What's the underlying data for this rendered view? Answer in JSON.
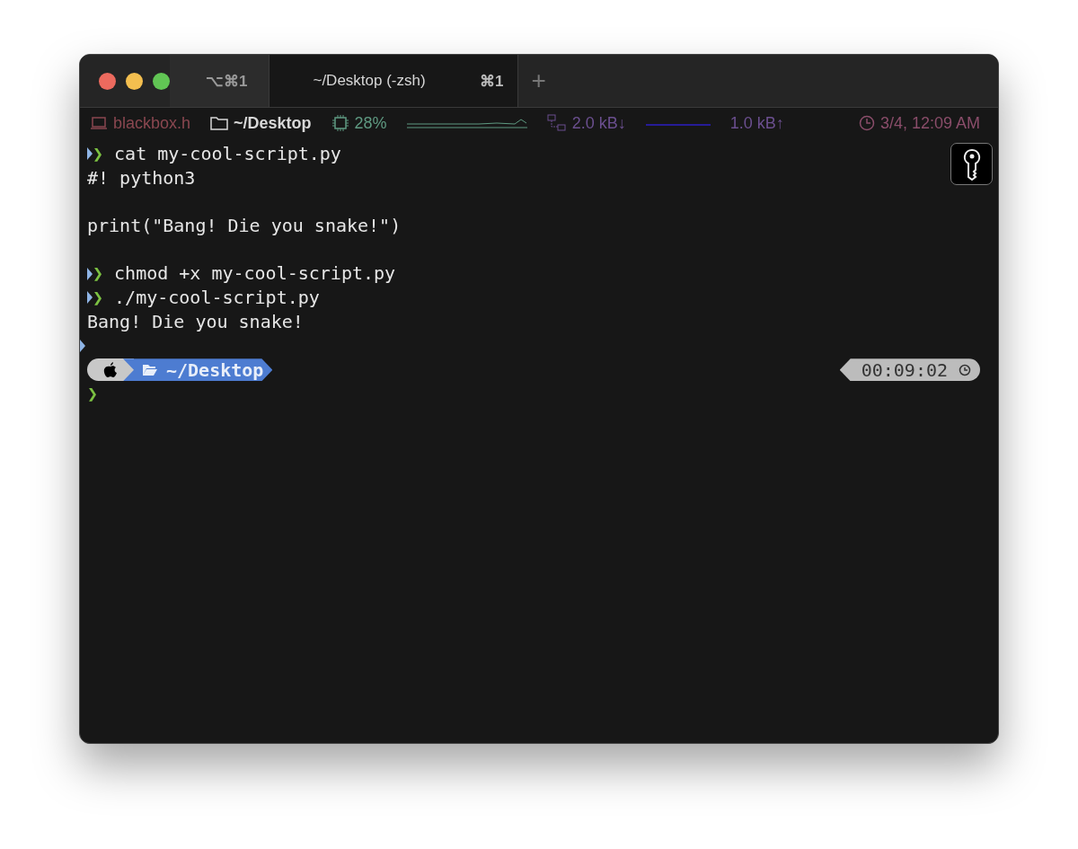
{
  "tabs": [
    {
      "label": "⌥⌘1",
      "selected": false
    },
    {
      "label": "~/Desktop (-zsh)",
      "shortcut": "⌘1",
      "selected": true
    }
  ],
  "new_tab": "+",
  "status_bar": [
    {
      "kind": "host",
      "text": "blackbox.h",
      "color": "#8a4750"
    },
    {
      "kind": "folder",
      "text": "~/Desktop",
      "color": "#d8d8d8"
    },
    {
      "kind": "cpu",
      "text": "28%",
      "color": "#5f9a82"
    },
    {
      "kind": "download",
      "text": "2.0 kB↓",
      "color": "#6b4f8f"
    },
    {
      "kind": "upload",
      "text": "1.0 kB↑",
      "color": "#6b4f8f"
    },
    {
      "kind": "clock",
      "text": "3/4, 12:09 AM",
      "color": "#8a4d6a"
    }
  ],
  "lines": [
    {
      "kind": "command",
      "prompt": "❯",
      "text": "cat my-cool-script.py"
    },
    {
      "kind": "output",
      "text": "#! python3"
    },
    {
      "kind": "blank"
    },
    {
      "kind": "output",
      "text": "print(\"Bang! Die you snake!\")"
    },
    {
      "kind": "blank"
    },
    {
      "kind": "command",
      "prompt": "❯",
      "text": "chmod +x my-cool-script.py"
    },
    {
      "kind": "command",
      "prompt": "❯",
      "text": "./my-cool-script.py"
    },
    {
      "kind": "output",
      "text": "Bang! Die you snake!"
    },
    {
      "kind": "mark"
    }
  ],
  "powerline": {
    "path": "~/Desktop",
    "elapsed": "00:09:02"
  },
  "input_prompt": "❯"
}
